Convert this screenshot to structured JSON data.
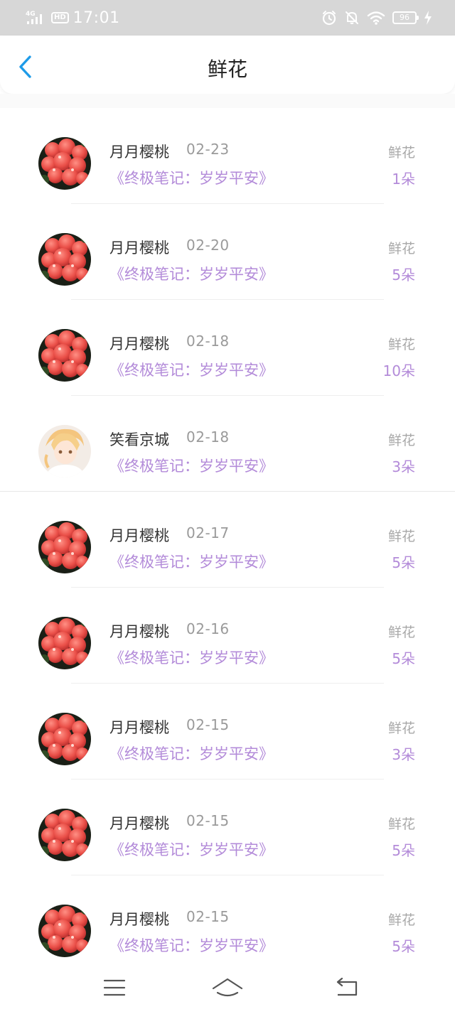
{
  "status_bar": {
    "network": "4G",
    "hd_badge": "HD",
    "time": "17:01",
    "battery": "96",
    "icons": [
      "signal-icon",
      "alarm-icon",
      "bell-off-icon",
      "wifi-icon",
      "battery-icon",
      "charging-icon"
    ]
  },
  "header": {
    "title": "鲜花",
    "back_icon": "chevron-left-icon"
  },
  "colors": {
    "accent_blue": "#1e9be8",
    "purple": "#b38bd9",
    "status_bar_bg": "#d7d7d7"
  },
  "records": [
    {
      "name": "月月樱桃",
      "date": "02-23",
      "book": "《终极笔记：岁岁平安》",
      "label": "鲜花",
      "count": "1朵",
      "avatar": "flower"
    },
    {
      "name": "月月樱桃",
      "date": "02-20",
      "book": "《终极笔记：岁岁平安》",
      "label": "鲜花",
      "count": "5朵",
      "avatar": "flower"
    },
    {
      "name": "月月樱桃",
      "date": "02-18",
      "book": "《终极笔记：岁岁平安》",
      "label": "鲜花",
      "count": "10朵",
      "avatar": "flower"
    },
    {
      "name": "笑看京城",
      "date": "02-18",
      "book": "《终极笔记：岁岁平安》",
      "label": "鲜花",
      "count": "3朵",
      "avatar": "anime"
    },
    {
      "name": "月月樱桃",
      "date": "02-17",
      "book": "《终极笔记：岁岁平安》",
      "label": "鲜花",
      "count": "5朵",
      "avatar": "flower"
    },
    {
      "name": "月月樱桃",
      "date": "02-16",
      "book": "《终极笔记：岁岁平安》",
      "label": "鲜花",
      "count": "5朵",
      "avatar": "flower"
    },
    {
      "name": "月月樱桃",
      "date": "02-15",
      "book": "《终极笔记：岁岁平安》",
      "label": "鲜花",
      "count": "3朵",
      "avatar": "flower"
    },
    {
      "name": "月月樱桃",
      "date": "02-15",
      "book": "《终极笔记：岁岁平安》",
      "label": "鲜花",
      "count": "5朵",
      "avatar": "flower"
    },
    {
      "name": "月月樱桃",
      "date": "02-15",
      "book": "《终极笔记：岁岁平安》",
      "label": "鲜花",
      "count": "5朵",
      "avatar": "flower"
    }
  ],
  "bottom_nav": {
    "icons": [
      "menu-icon",
      "home-icon",
      "return-icon"
    ]
  }
}
